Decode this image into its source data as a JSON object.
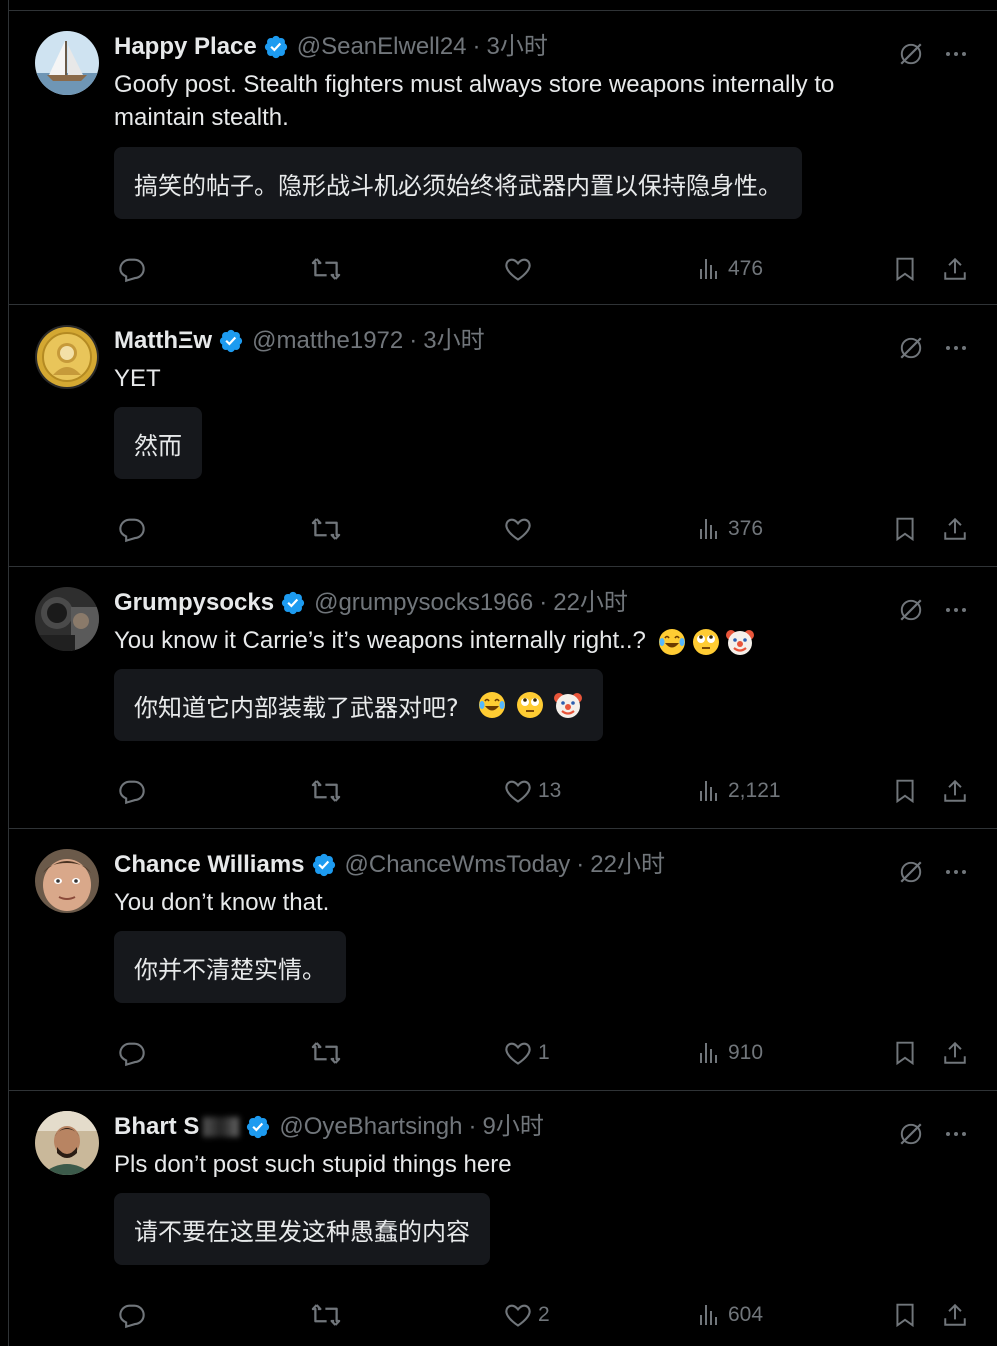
{
  "colors": {
    "background": "#000000",
    "text_primary": "#e7e9ea",
    "text_secondary": "#71767b",
    "verified_blue": "#1d9bf0",
    "translation_bg": "#16181c",
    "divider": "#2f3336"
  },
  "replies": [
    {
      "name": "Happy Place",
      "handle": "@SeanElwell24",
      "time": "3小时",
      "text_line1": "Goofy post. Stealth fighters must always store weapons internally to",
      "text_line2": "maintain stealth.",
      "translation": "搞笑的帖子。隐形战斗机必须始终将武器内置以保持隐身性。",
      "likes": "",
      "views": "476",
      "avatar_icon": "sailboat-avatar"
    },
    {
      "name": "MatthΞw",
      "handle": "@matthe1972",
      "time": "3小时",
      "text_line1": "YET",
      "text_line2": "",
      "translation": "然而",
      "likes": "",
      "views": "376",
      "avatar_icon": "gold-coin-avatar"
    },
    {
      "name": "Grumpysocks",
      "handle": "@grumpysocks1966",
      "time": "22小时",
      "text_line1": "You know it Carrie’s it’s weapons internally right..?",
      "text_line2": "",
      "translation": "你知道它内部装载了武器对吧?",
      "likes": "13",
      "views": "2,121",
      "avatar_icon": "person-in-car-avatar",
      "emojis": [
        "laughing-crying-emoji",
        "eye-roll-emoji",
        "clown-emoji"
      ]
    },
    {
      "name": "Chance Williams",
      "handle": "@ChanceWmsToday",
      "time": "22小时",
      "text_line1": "You don’t know that.",
      "text_line2": "",
      "translation": "你并不清楚实情。",
      "likes": "1",
      "views": "910",
      "avatar_icon": "face-avatar"
    },
    {
      "name": "Bhart S",
      "handle": "@OyeBhartsingh",
      "time": "9小时",
      "text_line1": "Pls don’t post such stupid things here",
      "text_line2": "",
      "translation": "请不要在这里发这种愚蠢的内容",
      "likes": "2",
      "views": "604",
      "avatar_icon": "man-portrait-avatar"
    }
  ],
  "separator": "·"
}
